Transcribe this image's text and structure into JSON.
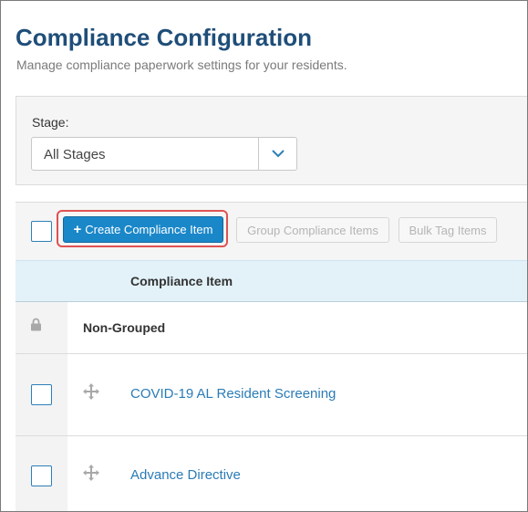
{
  "header": {
    "title": "Compliance Configuration",
    "subtitle": "Manage compliance paperwork settings for your residents."
  },
  "filter": {
    "stage_label": "Stage:",
    "stage_value": "All Stages"
  },
  "toolbar": {
    "create_label": "Create Compliance Item",
    "group_label": "Group Compliance Items",
    "bulk_tag_label": "Bulk Tag Items"
  },
  "table": {
    "column_header": "Compliance Item",
    "group_name": "Non-Grouped",
    "items": [
      {
        "name": "COVID-19 AL Resident Screening"
      },
      {
        "name": "Advance Directive"
      }
    ]
  },
  "colors": {
    "title": "#1f4e79",
    "primary_button": "#1a87c9",
    "highlight": "#e05252",
    "link": "#2a7bb6",
    "table_header": "#e3f1f9"
  },
  "icons": {
    "plus": "plus-icon",
    "caret": "chevron-down-icon",
    "lock": "lock-icon",
    "drag": "move-icon"
  }
}
